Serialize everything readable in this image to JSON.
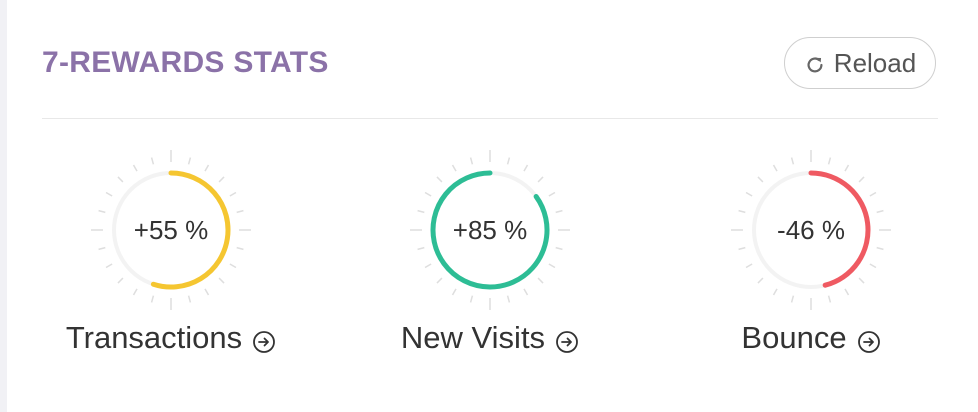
{
  "header": {
    "title": "7-REWARDS STATS",
    "reload_label": "Reload"
  },
  "colors": {
    "title": "#8b72a8",
    "track": "#f3f3f3",
    "ticks": "#dedede"
  },
  "stats": [
    {
      "value": 55,
      "value_text": "+55 %",
      "label": "Transactions",
      "color": "#f5c631",
      "direction": "clockwise"
    },
    {
      "value": 85,
      "value_text": "+85 %",
      "label": "New Visits",
      "color": "#2dbd95",
      "direction": "counterclockwise"
    },
    {
      "value": 46,
      "value_text": "-46 %",
      "label": "Bounce",
      "color": "#ef5a62",
      "direction": "clockwise"
    }
  ]
}
